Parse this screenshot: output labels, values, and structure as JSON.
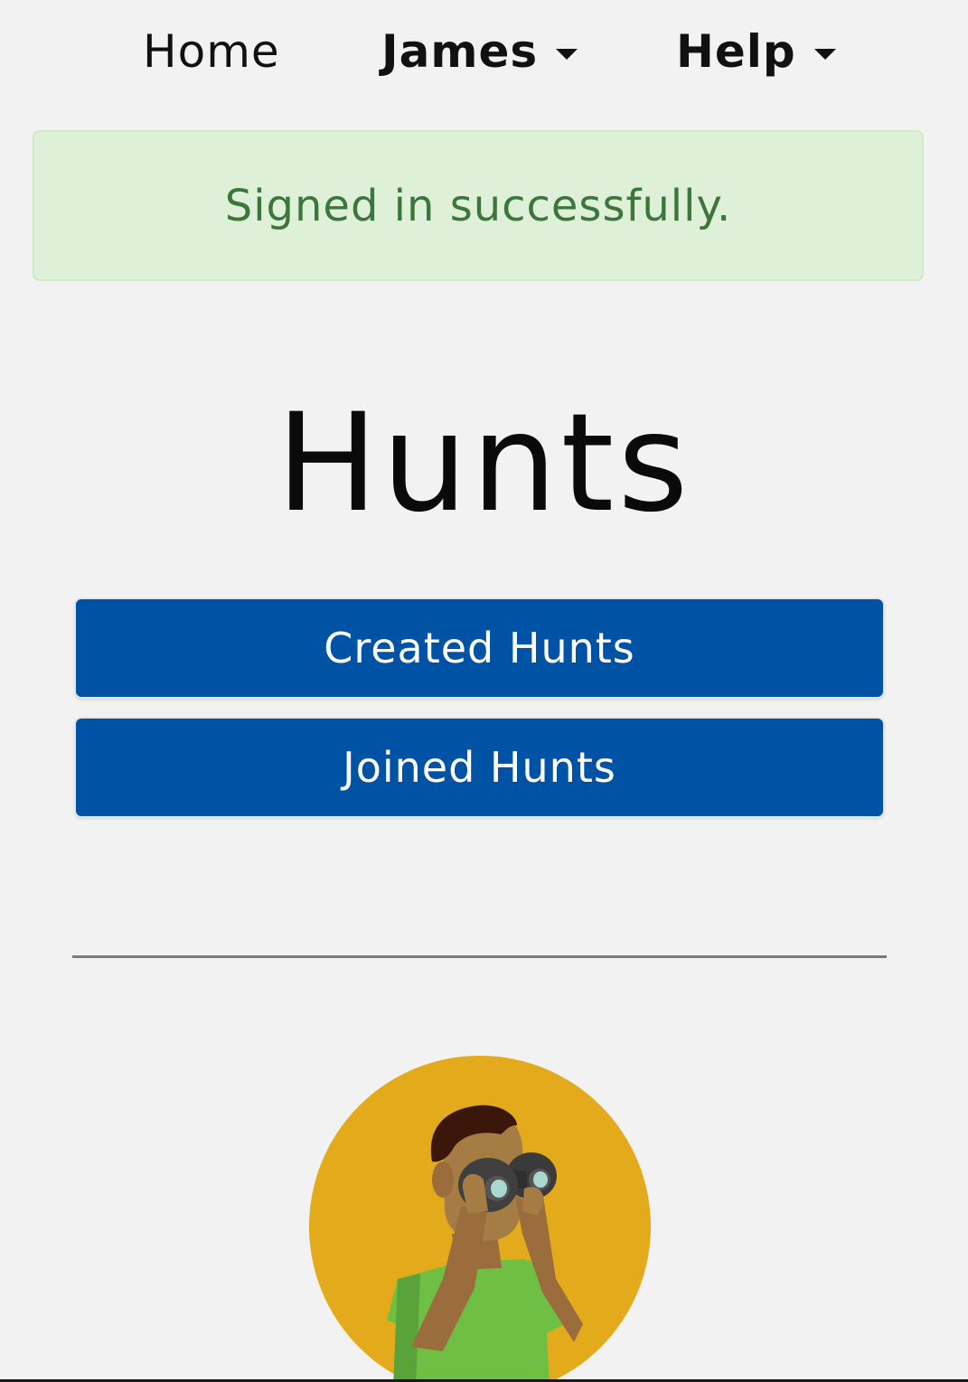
{
  "nav": {
    "home_label": "Home",
    "user_label": "James",
    "help_label": "Help"
  },
  "alert": {
    "message": "Signed in successfully."
  },
  "page": {
    "title": "Hunts"
  },
  "buttons": {
    "created_label": "Created Hunts",
    "joined_label": "Joined Hunts"
  },
  "colors": {
    "background": "#f2f2f2",
    "alert_bg": "#dff0d8",
    "alert_text": "#3c763d",
    "button_bg": "#0052a5",
    "illustration_circle": "#e3aa1b"
  },
  "icons": {
    "dropdown": "caret-down-icon",
    "illustration": "person-with-binoculars-illustration"
  }
}
